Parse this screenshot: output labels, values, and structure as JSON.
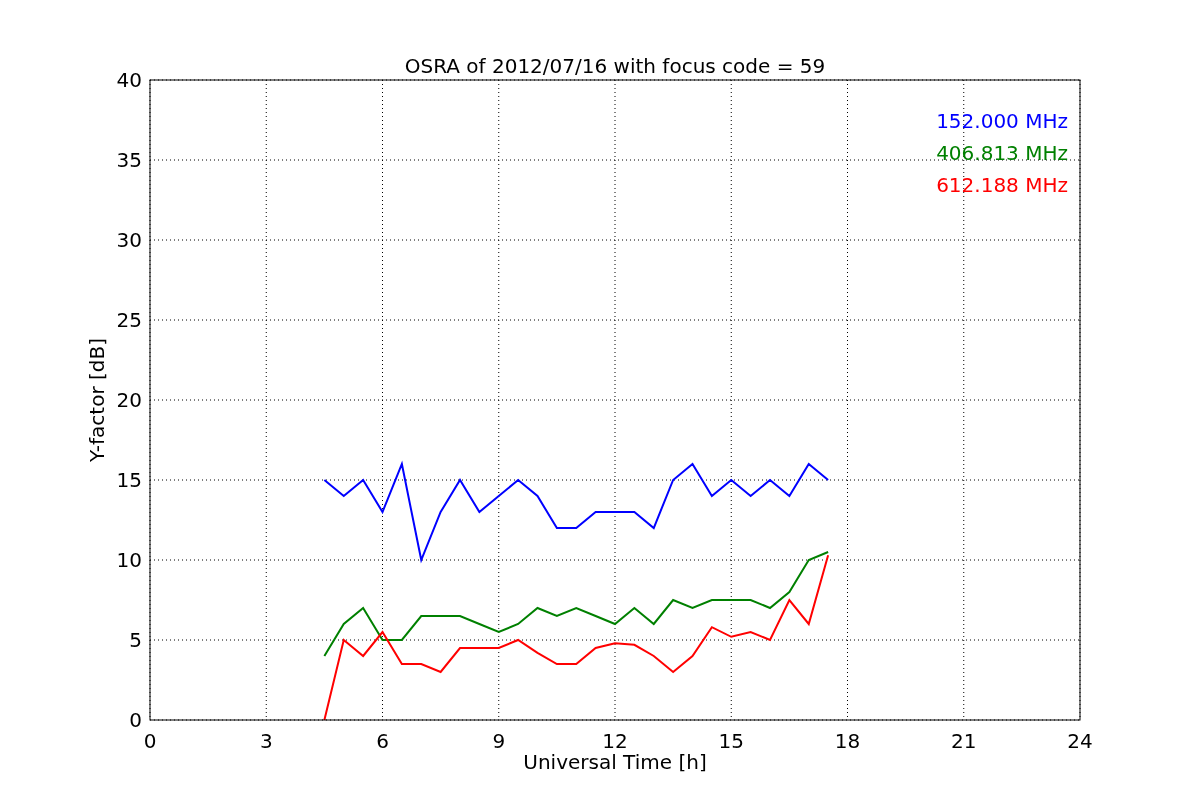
{
  "chart_data": {
    "type": "line",
    "title": "OSRA of 2012/07/16 with focus code = 59",
    "xlabel": "Universal Time [h]",
    "ylabel": "Y-factor [dB]",
    "x": [
      4.5,
      5,
      5.5,
      6,
      6.5,
      7,
      7.5,
      8,
      8.5,
      9,
      9.5,
      10,
      10.5,
      11,
      11.5,
      12,
      12.5,
      13,
      13.5,
      14,
      14.5,
      15,
      15.5,
      16,
      16.5,
      17,
      17.5
    ],
    "series": [
      {
        "name": "152.000 MHz",
        "color": "#0000ff",
        "values": [
          15,
          14,
          15,
          13,
          16,
          10,
          13,
          15,
          13,
          14,
          15,
          14,
          12,
          12,
          13,
          13,
          13,
          12,
          15,
          16,
          14,
          15,
          14,
          15,
          14,
          16,
          15
        ]
      },
      {
        "name": "406.813 MHz",
        "color": "#008000",
        "values": [
          4,
          6,
          7,
          5,
          5,
          6.5,
          6.5,
          6.5,
          6,
          5.5,
          6,
          7,
          6.5,
          7,
          6.5,
          6,
          7,
          6,
          7.5,
          7,
          7.5,
          7.5,
          7.5,
          7,
          8,
          10,
          10.5
        ]
      },
      {
        "name": "612.188 MHz",
        "color": "#ff0000",
        "values": [
          0,
          5,
          4,
          5.5,
          3.5,
          3.5,
          3,
          4.5,
          4.5,
          4.5,
          5,
          4.2,
          3.5,
          3.5,
          4.5,
          4.8,
          4.7,
          4,
          3,
          4,
          5.8,
          5.2,
          5.5,
          5,
          7.5,
          6,
          10.3
        ]
      }
    ],
    "grid": true,
    "xlim": [
      0,
      24
    ],
    "ylim": [
      0,
      40
    ],
    "xticks": [
      0,
      3,
      6,
      9,
      12,
      15,
      18,
      21,
      24
    ],
    "yticks": [
      0,
      5,
      10,
      15,
      20,
      25,
      30,
      35,
      40
    ]
  }
}
